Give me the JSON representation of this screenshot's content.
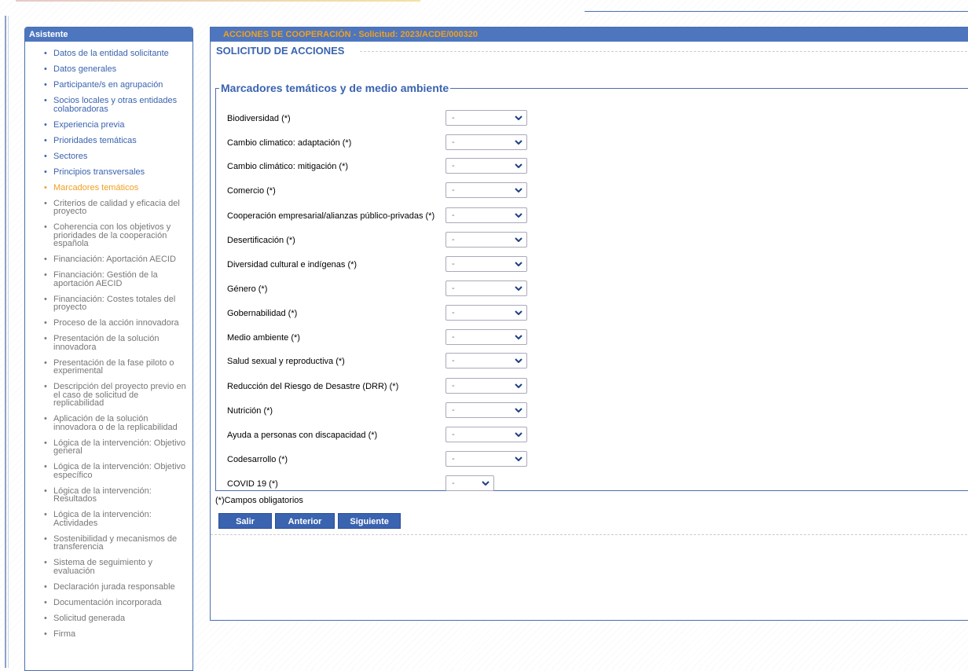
{
  "sidebar": {
    "title": "Asistente",
    "items": [
      {
        "label": "Datos de la entidad solicitante",
        "state": "active"
      },
      {
        "label": "Datos generales",
        "state": "active"
      },
      {
        "label": "Participante/s en agrupación",
        "state": "active"
      },
      {
        "label": "Socios locales y otras entidades colaboradoras",
        "state": "active"
      },
      {
        "label": "Experiencia previa",
        "state": "active"
      },
      {
        "label": "Prioridades temáticas",
        "state": "active"
      },
      {
        "label": "Sectores",
        "state": "active"
      },
      {
        "label": "Principios transversales",
        "state": "active"
      },
      {
        "label": "Marcadores temáticos",
        "state": "current"
      },
      {
        "label": "Criterios de calidad y eficacia del proyecto",
        "state": "inactive"
      },
      {
        "label": "Coherencia con los objetivos y prioridades de la cooperación española",
        "state": "inactive"
      },
      {
        "label": "Financiación: Aportación AECID",
        "state": "inactive"
      },
      {
        "label": "Financiación: Gestión de la aportación AECID",
        "state": "inactive"
      },
      {
        "label": "Financiación: Costes totales del proyecto",
        "state": "inactive"
      },
      {
        "label": "Proceso de la acción innovadora",
        "state": "inactive"
      },
      {
        "label": "Presentación de la solución innovadora",
        "state": "inactive"
      },
      {
        "label": "Presentación de la fase piloto o experimental",
        "state": "inactive"
      },
      {
        "label": "Descripción del proyecto previo en el caso de solicitud de replicabilidad",
        "state": "inactive"
      },
      {
        "label": "Aplicación de la solución innovadora o de la replicabilidad",
        "state": "inactive"
      },
      {
        "label": "Lógica de la intervención: Objetivo general",
        "state": "inactive"
      },
      {
        "label": "Lógica de la intervención: Objetivo específico",
        "state": "inactive"
      },
      {
        "label": "Lógica de la intervención: Resultados",
        "state": "inactive"
      },
      {
        "label": "Lógica de la intervención: Actividades",
        "state": "inactive"
      },
      {
        "label": "Sostenibilidad y mecanismos de transferencia",
        "state": "inactive"
      },
      {
        "label": "Sistema de seguimiento y evaluación",
        "state": "inactive"
      },
      {
        "label": "Declaración jurada responsable",
        "state": "inactive"
      },
      {
        "label": "Documentación incorporada",
        "state": "inactive"
      },
      {
        "label": "Solicitud generada",
        "state": "inactive"
      },
      {
        "label": "Firma",
        "state": "inactive"
      }
    ]
  },
  "main": {
    "header": "ACCIONES DE COOPERACIÓN - Solicitud: 2023/ACDE/000320",
    "section_title": "SOLICITUD DE ACCIONES",
    "fieldset_legend": "Marcadores temáticos y de medio ambiente",
    "fields": [
      {
        "label": "Biodiversidad  (*)",
        "value": "-"
      },
      {
        "label": "Cambio climatico: adaptación  (*)",
        "value": "-"
      },
      {
        "label": "Cambio climático: mitigación  (*)",
        "value": "-"
      },
      {
        "label": "Comercio  (*)",
        "value": "-"
      },
      {
        "label": "Cooperación empresarial/alianzas público-privadas  (*)",
        "value": "-"
      },
      {
        "label": "Desertificación  (*)",
        "value": "-"
      },
      {
        "label": "Diversidad cultural e indígenas  (*)",
        "value": "-"
      },
      {
        "label": "Género  (*)",
        "value": "-"
      },
      {
        "label": "Gobernabilidad  (*)",
        "value": "-"
      },
      {
        "label": "Medio ambiente  (*)",
        "value": "-"
      },
      {
        "label": "Salud sexual y reproductiva  (*)",
        "value": "-"
      },
      {
        "label": "Reducción del Riesgo de Desastre (DRR)  (*)",
        "value": "-"
      },
      {
        "label": "Nutrición  (*)",
        "value": "-"
      },
      {
        "label": "Ayuda a personas con discapacidad  (*)",
        "value": "-"
      },
      {
        "label": "Codesarrollo  (*)",
        "value": "-"
      },
      {
        "label": "COVID 19  (*)",
        "value": "-"
      }
    ],
    "required_note": "(*)Campos obligatorios",
    "buttons": {
      "exit": "Salir",
      "previous": "Anterior",
      "next": "Siguiente"
    }
  },
  "colors": {
    "header_blue": "#4d76bf",
    "link_blue": "#3a63b0",
    "current_orange": "#f0a020"
  }
}
